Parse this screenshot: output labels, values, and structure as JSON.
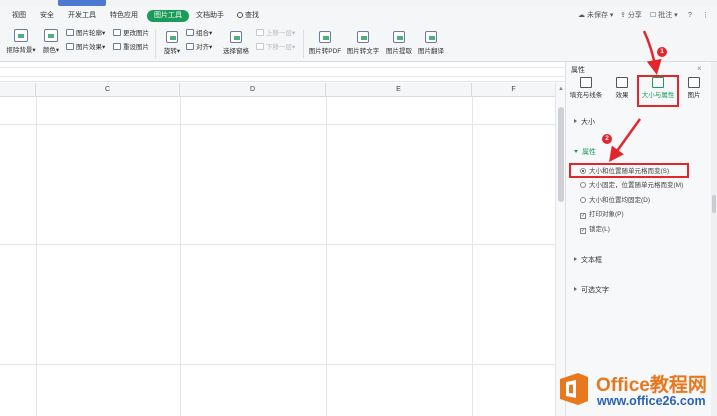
{
  "menu": {
    "items": [
      "视图",
      "安全",
      "开发工具",
      "特色应用",
      "图片工具",
      "文档助手"
    ],
    "active": "图片工具",
    "search": "查找",
    "unsaved": "未保存",
    "share": "分享",
    "comment": "批注",
    "help": "?",
    "more": "⋮"
  },
  "ribbon": {
    "remove_bg": "抠除背景",
    "color": "颜色",
    "outline": "图片轮廓",
    "effect": "图片效果",
    "change_pic": "更改图片",
    "reset_pic": "重设图片",
    "rotate": "旋转",
    "combine": "组合",
    "align": "对齐",
    "select_pane": "选择窗格",
    "bring_forward": "上移一层",
    "send_backward": "下移一层",
    "to_pdf": "图片转PDF",
    "to_text": "图片转文字",
    "extract": "图片提取",
    "translate": "图片翻译"
  },
  "sheet": {
    "columns": [
      "C",
      "D",
      "E",
      "F"
    ]
  },
  "pane": {
    "title": "属性",
    "close": "×",
    "tabs": [
      "填充与线条",
      "效果",
      "大小与属性",
      "图片"
    ],
    "active_tab": "大小与属性",
    "sections": {
      "size": "大小",
      "properties": "属性",
      "textbox": "文本框",
      "alt_text": "可选文字"
    },
    "options": {
      "opt1": "大小和位置随单元格而变(S)",
      "opt2": "大小固定，位置随单元格而变(M)",
      "opt3": "大小和位置均固定(D)",
      "print": "打印对象(P)",
      "lock": "锁定(L)"
    },
    "selected_option": "大小和位置随单元格而变(S)"
  },
  "annotations": {
    "badge1": "1",
    "badge2": "2"
  },
  "watermark": {
    "name": "Office教程网",
    "url": "www.office26.com"
  },
  "colors": {
    "accent_green": "#1a9b58",
    "annotation_red": "#e3262c",
    "watermark_orange": "#e8771e",
    "watermark_blue": "#2a63b5"
  }
}
